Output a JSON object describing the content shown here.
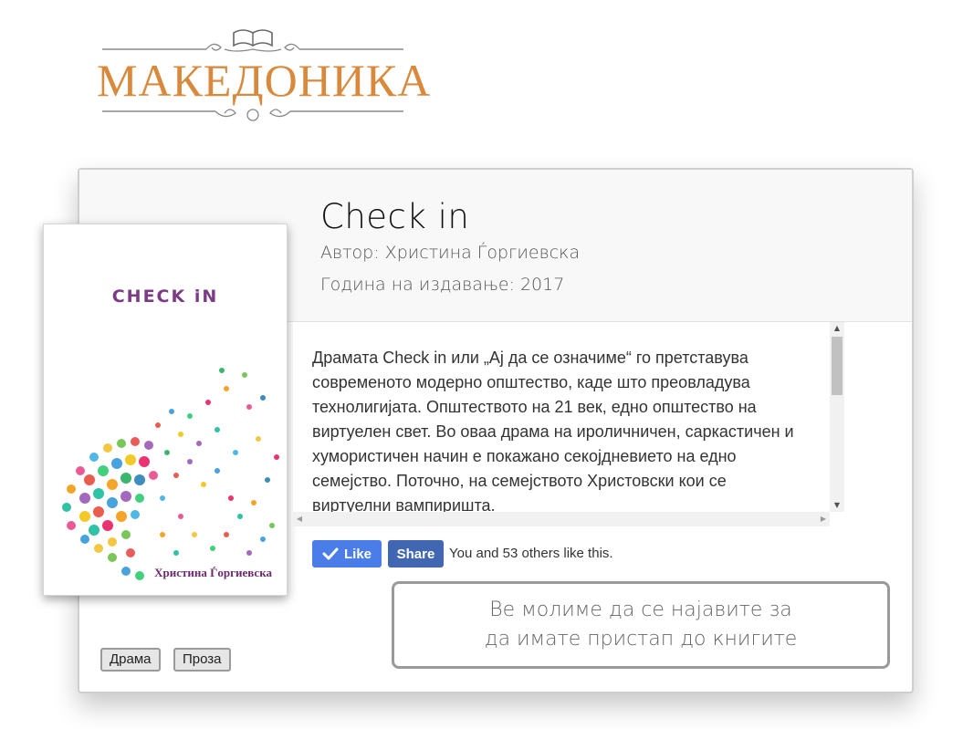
{
  "logo": {
    "text": "МАКЕДОНИКА"
  },
  "book": {
    "title": "Check in",
    "author": "Автор: Христина Ѓоргиевска",
    "year": "Година на издавање: 2017",
    "cover_title": "CHECK iN",
    "cover_author": "Христина Ѓоргиевска",
    "description": "Драмата Check in или „Ај да се означиме“ го претставува современото модерно општество, каде што преовладува технолигијата. Општеството на 21 век, едно општество на виртуелен свет. Во оваа драма на ироличничен, саркастичен и хумористичен начин е покажано секојдневието на едно семејство. Поточно, на семејството Христовски кои се виртуелни вампиришта."
  },
  "social": {
    "like_label": "Like",
    "share_label": "Share",
    "like_count_text": "You and 53 others like this."
  },
  "login_prompt": {
    "line1": "Ве молиме да се најавите за",
    "line2": "да имате пристап до книгите"
  },
  "tags": [
    "Драма",
    "Проза"
  ],
  "colors": {
    "logo": "#d9893c",
    "like_blue": "#4a7de8",
    "share_blue": "#4267b2",
    "cover_title": "#7b3b86"
  }
}
